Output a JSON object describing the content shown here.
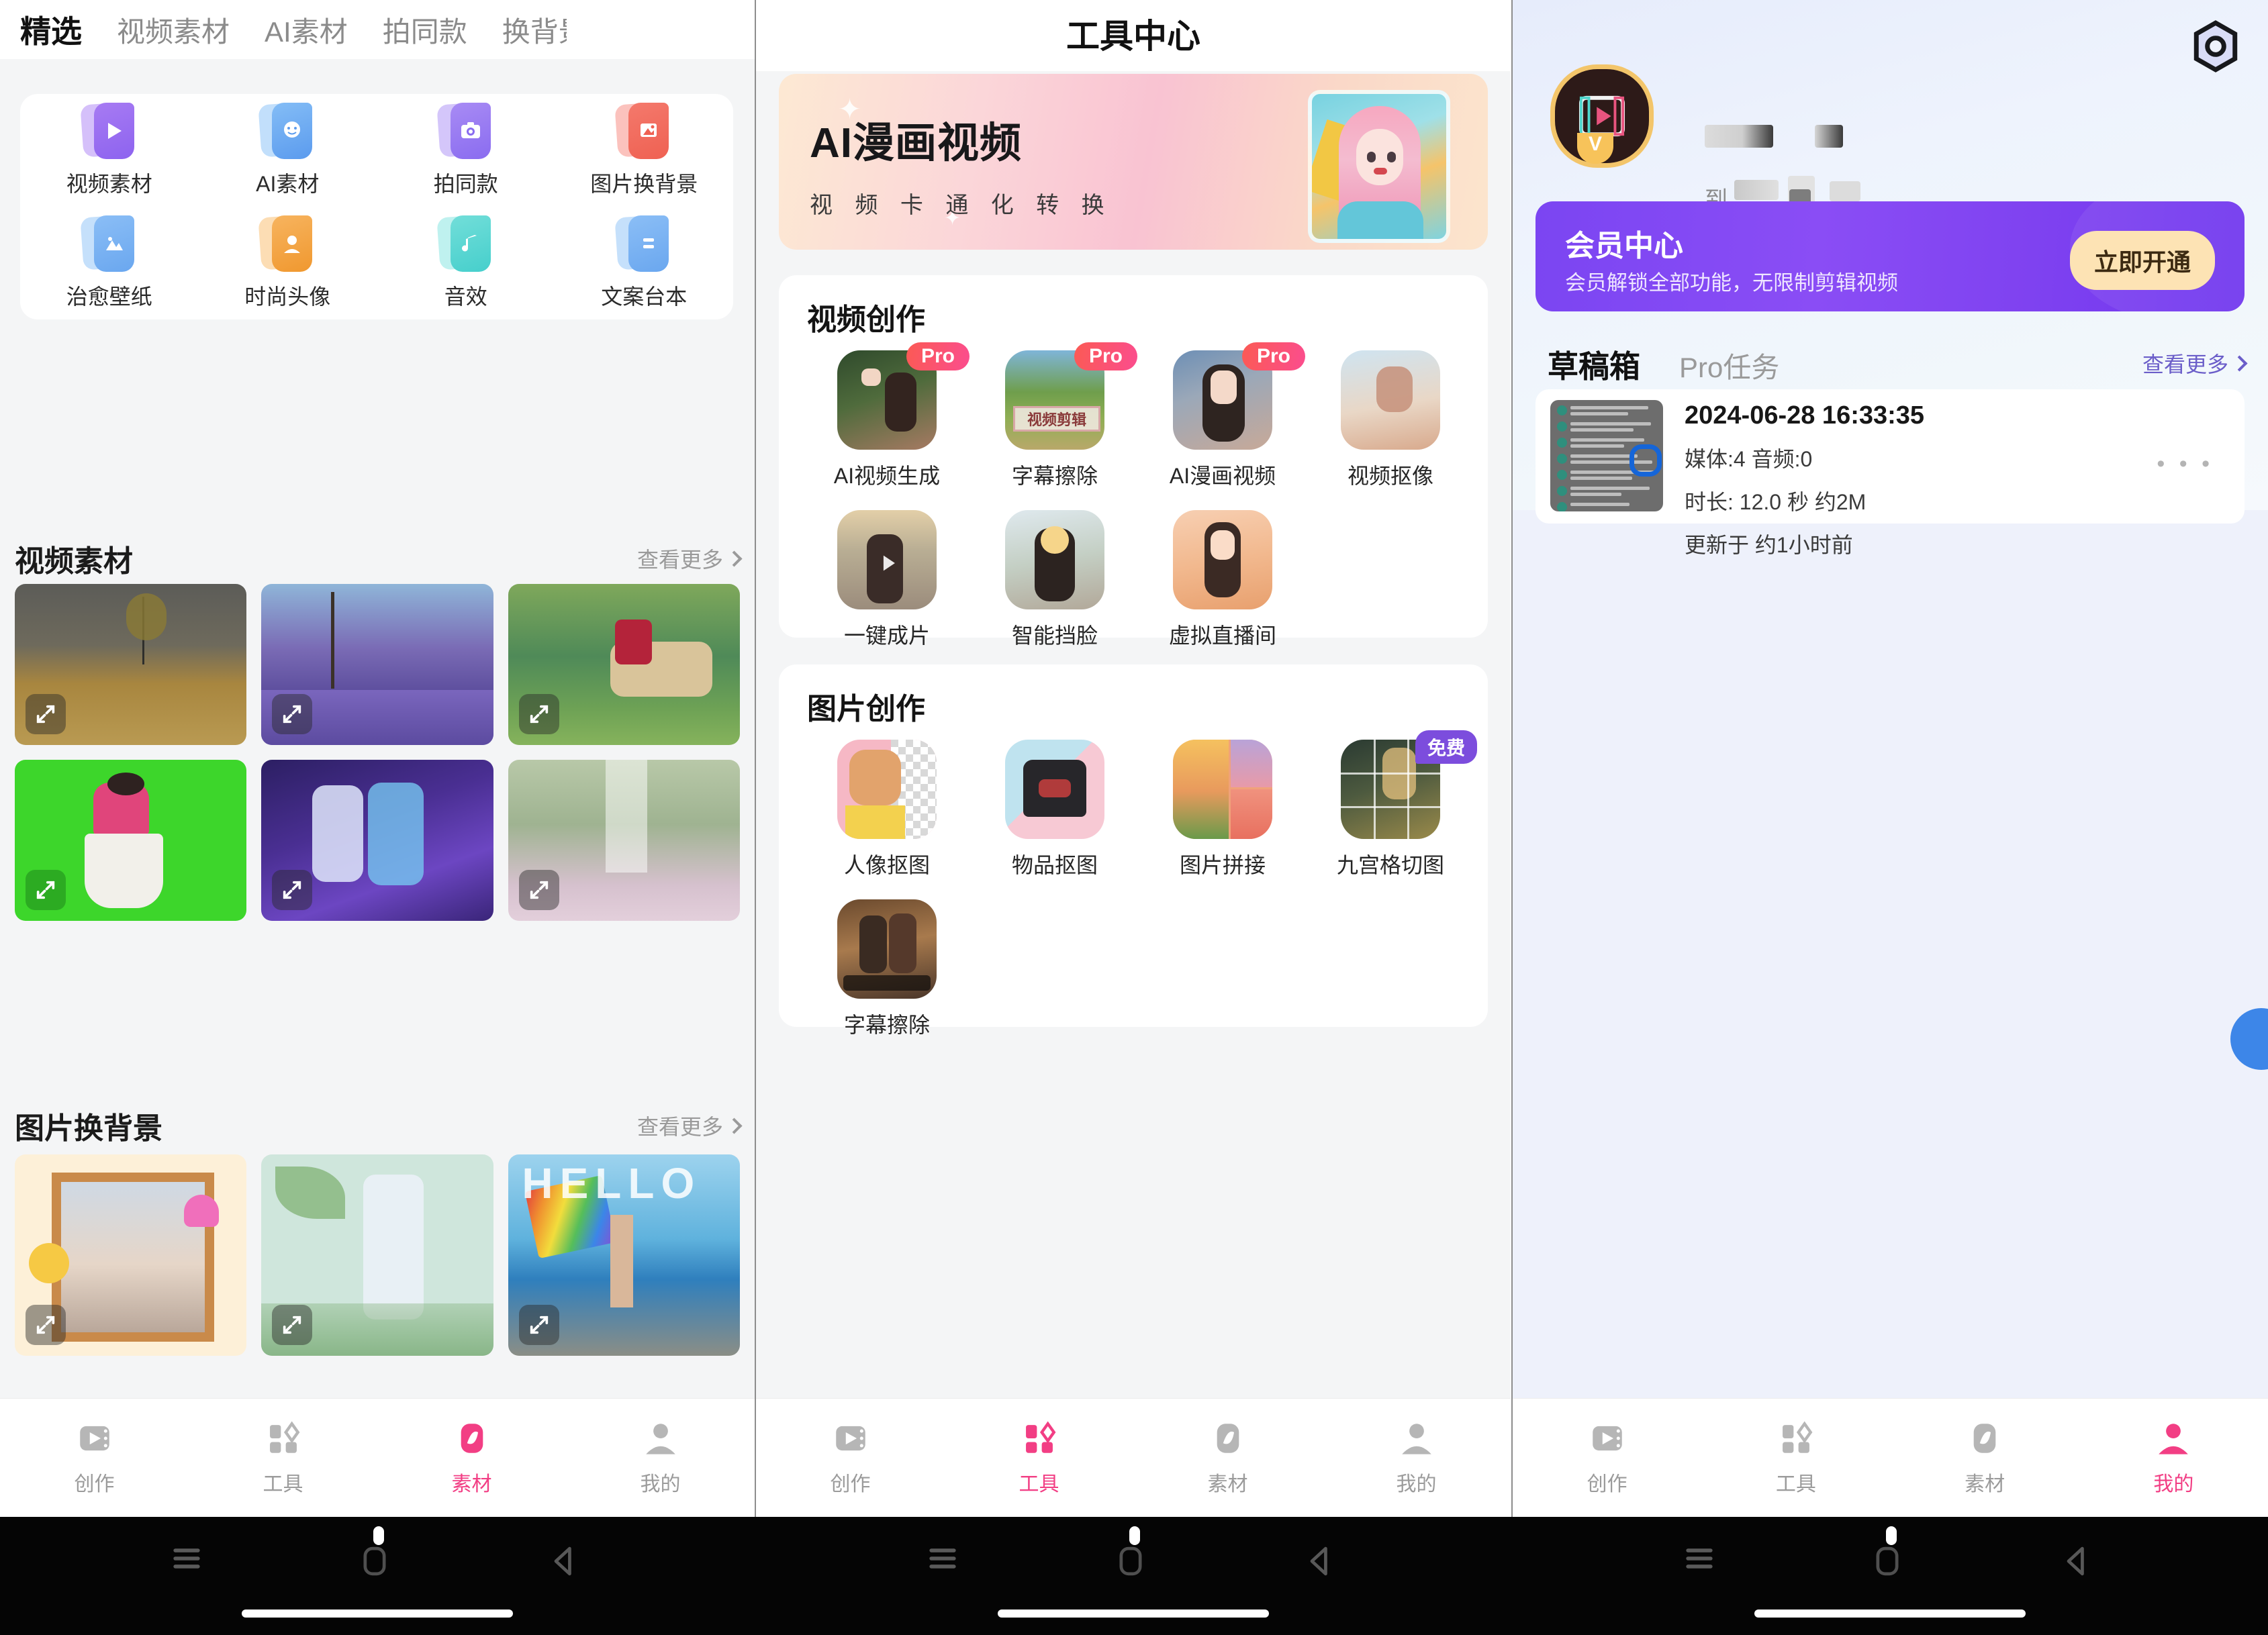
{
  "panel1": {
    "tabs": [
      {
        "label": "精选",
        "active": true
      },
      {
        "label": "视频素材",
        "active": false
      },
      {
        "label": "AI素材",
        "active": false
      },
      {
        "label": "拍同款",
        "active": false
      },
      {
        "label": "换背景",
        "active": false
      }
    ],
    "quick_entries": [
      {
        "label": "视频素材",
        "icon": "play-icon",
        "color1": "#b38df5",
        "color2": "#8d63ef"
      },
      {
        "label": "AI素材",
        "icon": "face-icon",
        "color1": "#8fc4f7",
        "color2": "#5b9bee"
      },
      {
        "label": "拍同款",
        "icon": "camera-icon",
        "color1": "#b197f6",
        "color2": "#8a6cf0"
      },
      {
        "label": "图片换背景",
        "icon": "image-swap-icon",
        "color1": "#f79086",
        "color2": "#ef6152"
      },
      {
        "label": "治愈壁纸",
        "icon": "landscape-icon",
        "color1": "#95c6f7",
        "color2": "#6aa7ef"
      },
      {
        "label": "时尚头像",
        "icon": "person-icon",
        "color1": "#f9c177",
        "color2": "#f0982f"
      },
      {
        "label": "音效",
        "icon": "music-note-icon",
        "color1": "#8ae5e1",
        "color2": "#46cfcc"
      },
      {
        "label": "文案台本",
        "icon": "script-icon",
        "color1": "#95c6f7",
        "color2": "#6aa7ef"
      }
    ],
    "sections": [
      {
        "title": "视频素材",
        "more": "查看更多",
        "thumbs": [
          {
            "name": "autumn-field-video",
            "kind": "field"
          },
          {
            "name": "purple-blossom-street-video",
            "kind": "blossom"
          },
          {
            "name": "horse-rider-video",
            "kind": "horse"
          },
          {
            "name": "green-screen-dancer-video",
            "kind": "greenscreen"
          },
          {
            "name": "anime-couple-video",
            "kind": "anime"
          },
          {
            "name": "petal-path-video",
            "kind": "petal"
          }
        ]
      },
      {
        "title": "图片换背景",
        "more": "查看更多",
        "thumbs": [
          {
            "name": "framed-portrait-template",
            "kind": "frame"
          },
          {
            "name": "may-hello-template",
            "kind": "may"
          },
          {
            "name": "seaside-rainbow-template",
            "kind": "sea"
          }
        ]
      }
    ],
    "bottom_nav": [
      {
        "label": "创作",
        "icon": "film-play-icon",
        "active": false
      },
      {
        "label": "工具",
        "icon": "grid-tools-icon",
        "active": false
      },
      {
        "label": "素材",
        "icon": "leaf-icon",
        "active": true
      },
      {
        "label": "我的",
        "icon": "user-icon",
        "active": false
      }
    ]
  },
  "panel2": {
    "title": "工具中心",
    "banner": {
      "headline": "AI漫画视频",
      "subline": "视 频 卡 通 化 转 换",
      "art": "anime-girl-pink-hair"
    },
    "sections": [
      {
        "title": "视频创作",
        "tools": [
          {
            "label": "AI视频生成",
            "badge": "Pro",
            "art": "girl-white-top"
          },
          {
            "label": "字幕擦除",
            "badge": "Pro",
            "art": "landscape-painting",
            "overlay": "视频剪辑"
          },
          {
            "label": "AI漫画视频",
            "badge": "Pro",
            "art": "girl-city"
          },
          {
            "label": "视频抠像",
            "badge": "",
            "art": "girl-sky"
          },
          {
            "label": "一键成片",
            "badge": "",
            "art": "girl-road"
          },
          {
            "label": "智能挡脸",
            "badge": "",
            "art": "girl-cat-sticker"
          },
          {
            "label": "虚拟直播间",
            "badge": "",
            "art": "girl-orange"
          }
        ]
      },
      {
        "title": "图片创作",
        "tools": [
          {
            "label": "人像抠图",
            "badge": "",
            "art": "cutout-portrait"
          },
          {
            "label": "物品抠图",
            "badge": "",
            "art": "black-tshirt"
          },
          {
            "label": "图片拼接",
            "badge": "",
            "art": "sunset-collage"
          },
          {
            "label": "九宫格切图",
            "badge": "免费",
            "art": "grid-cut-portrait"
          },
          {
            "label": "字幕擦除",
            "badge": "",
            "art": "movie-still"
          }
        ]
      }
    ],
    "bottom_nav": [
      {
        "label": "创作",
        "icon": "film-play-icon",
        "active": false
      },
      {
        "label": "工具",
        "icon": "grid-tools-icon",
        "active": true
      },
      {
        "label": "素材",
        "icon": "leaf-icon",
        "active": false
      },
      {
        "label": "我的",
        "icon": "user-icon",
        "active": false
      }
    ]
  },
  "panel3": {
    "settings_icon": "hex-gear-icon",
    "avatar": "film-play-avatar",
    "verified_badge": "V",
    "nickname_masked": "",
    "subtitle_prefix": "到",
    "membership": {
      "title": "会员中心",
      "subtitle": "会员解锁全部功能，无限制剪辑视频",
      "cta": "立即开通"
    },
    "tabs": [
      {
        "label": "草稿箱",
        "active": true
      },
      {
        "label": "Pro任务",
        "active": false
      }
    ],
    "more": "查看更多",
    "draft": {
      "timestamp": "2024-06-28 16:33:35",
      "media_line": "媒体:4   音频:0",
      "duration_line": "时长: 12.0 秒  约2M",
      "updated_line": "更新于 约1小时前",
      "menu": "• • •"
    },
    "fab": "blue-circle-fab",
    "bottom_nav": [
      {
        "label": "创作",
        "icon": "film-play-icon",
        "active": false
      },
      {
        "label": "工具",
        "icon": "grid-tools-icon",
        "active": false
      },
      {
        "label": "素材",
        "icon": "leaf-icon",
        "active": false
      },
      {
        "label": "我的",
        "icon": "user-icon",
        "active": true
      }
    ]
  },
  "system_nav": {
    "menu": "menu-icon",
    "home": "home-icon",
    "back": "back-icon"
  },
  "colors": {
    "accent_pink": "#f23e84",
    "pro_badge": "#fb4d8e",
    "free_badge": "#7c4ddd",
    "member_purple": "#7b45f2",
    "cta_cream": "#fde3b4"
  }
}
